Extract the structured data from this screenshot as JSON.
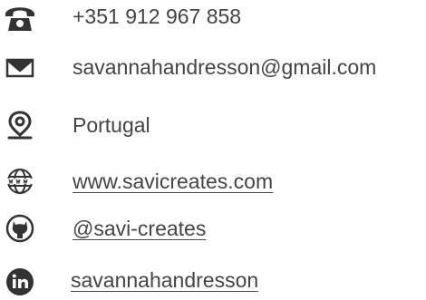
{
  "contact": {
    "phone": {
      "icon": "telephone-icon",
      "text": "+351 912 967 858"
    },
    "email": {
      "icon": "envelope-icon",
      "text": "savannahandresson@gmail.com"
    },
    "location": {
      "icon": "map-pin-icon",
      "text": "Portugal"
    },
    "website": {
      "icon": "globe-www-icon",
      "text": "www.savicreates.com"
    },
    "github": {
      "icon": "github-icon",
      "text": "@savi-creates"
    },
    "linkedin": {
      "icon": "linkedin-icon",
      "text": "savannahandresson"
    }
  },
  "colors": {
    "icon": "#333333",
    "text": "#444444"
  }
}
